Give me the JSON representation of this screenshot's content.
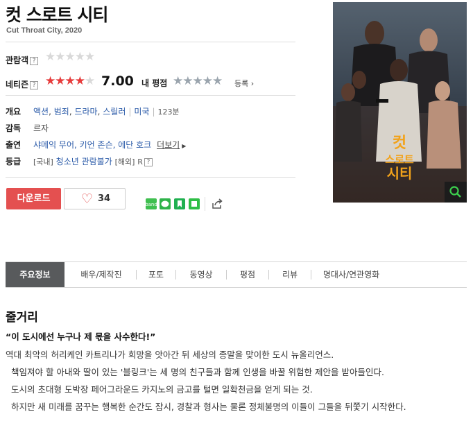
{
  "movie": {
    "title": "컷 스로트 시티",
    "subtitle": "Cut Throat City, 2020"
  },
  "ratings": {
    "audience_label": "관람객",
    "netizen_label": "네티즌",
    "netizen_score": "7.00",
    "netizen_stars_fraction": 0.7,
    "my_rating_label": "내 평점",
    "register_label": "등록",
    "qmark": "?"
  },
  "info": {
    "overview_label": "개요",
    "genres": [
      "액션",
      "범죄",
      "드라마",
      "스릴러"
    ],
    "country": "미국",
    "runtime": "123분",
    "director_label": "감독",
    "director": "르자",
    "cast_label": "출연",
    "cast": "샤메익 무어, 키언 존슨, 에단 호크",
    "more_label": "더보기",
    "grade_label": "등급",
    "grade_domestic_tag": "[국내]",
    "grade_domestic": "청소년 관람불가",
    "grade_foreign_tag": "[해외]",
    "grade_foreign": "R"
  },
  "actions": {
    "download_label": "다운로드",
    "like_count": "34"
  },
  "poster": {
    "title_line1": "컷",
    "title_line2": "스로트",
    "title_line3": "시티"
  },
  "tabs": [
    "주요정보",
    "배우/제작진",
    "포토",
    "동영상",
    "평점",
    "리뷰",
    "명대사/연관영화"
  ],
  "synopsis": {
    "heading": "줄거리",
    "tagline": "“이 도시에선 누구나 제 몫을 사수한다!”",
    "lines": [
      "역대 최악의 허리케인 카트리나가 희망을 앗아간 뒤 세상의 종말을 맞이한 도시 뉴올리언스.",
      "책임져야 할 아내와 딸이 있는 '블링크'는 세 명의 친구들과 함께 인생을 바꿀 위험한 제안을 받아들인다.",
      "도시의 초대형 도박장 페어그라운드 카지노의 금고를 털면 일확천금을 얻게 되는 것.",
      "하지만 새 미래를 꿈꾸는 행복한 순간도 잠시, 경찰과 형사는 물론 정체불명의 이들이 그들을 뒤쫓기 시작한다."
    ]
  },
  "colors": {
    "accent_red": "#e45050",
    "link_blue": "#2a5aa8",
    "active_tab": "#585a5c",
    "poster_title": "#f2a21a"
  }
}
